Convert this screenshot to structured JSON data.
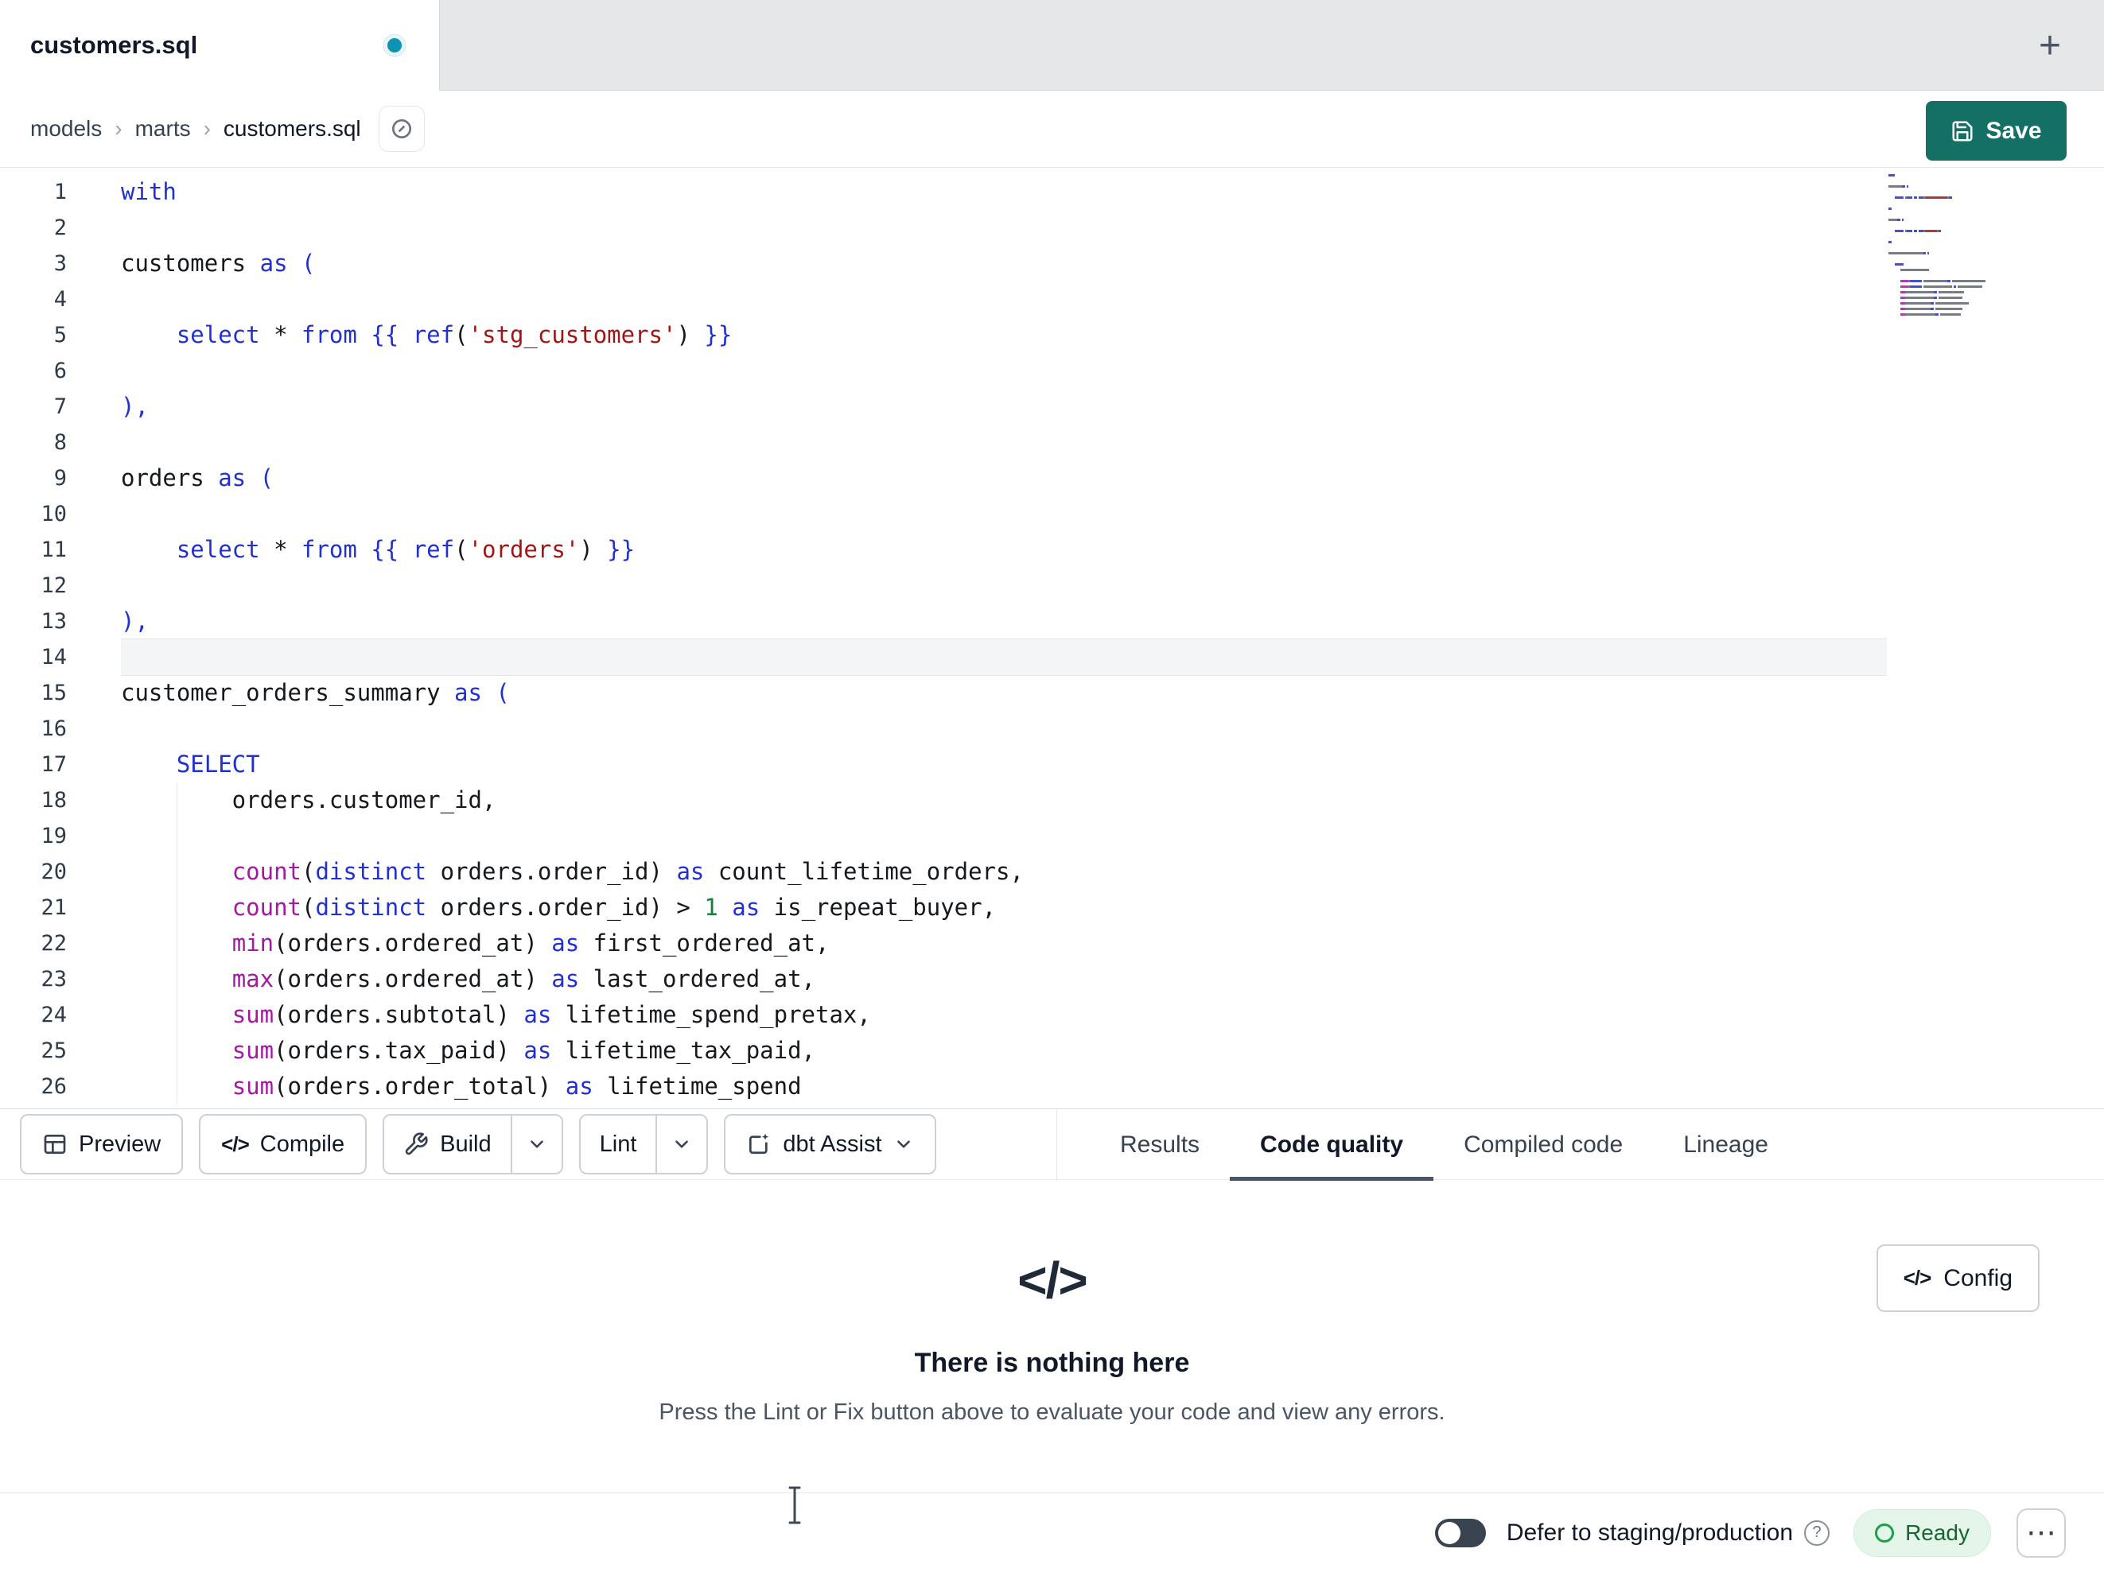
{
  "tab": {
    "title": "customers.sql",
    "new_tab": "+"
  },
  "breadcrumb": {
    "items": [
      "models",
      "marts",
      "customers.sql"
    ]
  },
  "save": {
    "label": "Save"
  },
  "toolbar": {
    "preview": "Preview",
    "compile": "Compile",
    "build": "Build",
    "lint": "Lint",
    "assist": "dbt Assist"
  },
  "panel_tabs": [
    {
      "label": "Results",
      "active": false
    },
    {
      "label": "Code quality",
      "active": true
    },
    {
      "label": "Compiled code",
      "active": false
    },
    {
      "label": "Lineage",
      "active": false
    }
  ],
  "empty_state": {
    "title": "There is nothing here",
    "subtitle": "Press the Lint or Fix button above to evaluate your code and view any errors.",
    "config": "Config"
  },
  "statusbar": {
    "defer_label": "Defer to staging/production",
    "help": "?",
    "ready": "Ready",
    "menu": "⋯"
  },
  "icons": {
    "code_glyph": "</>"
  },
  "colors": {
    "keyword": "#2130d2",
    "function": "#a617a3",
    "string": "#a31515",
    "number": "#15803d",
    "save_button": "#147065",
    "unsaved_dot": "#0f93b4",
    "ready_green": "#19a24a"
  },
  "editor": {
    "active_line": 14,
    "lines": [
      {
        "n": 1,
        "t": [
          [
            "kw",
            "with"
          ]
        ]
      },
      {
        "n": 2,
        "t": []
      },
      {
        "n": 3,
        "t": [
          [
            "tx",
            "customers "
          ],
          [
            "kw",
            "as"
          ],
          [
            "tx",
            " "
          ],
          [
            "kw",
            "("
          ]
        ]
      },
      {
        "n": 4,
        "t": []
      },
      {
        "n": 5,
        "t": [
          [
            "tx",
            "    "
          ],
          [
            "kw",
            "select"
          ],
          [
            "tx",
            " * "
          ],
          [
            "kw",
            "from"
          ],
          [
            "tx",
            " "
          ],
          [
            "kw",
            "{{"
          ],
          [
            "tx",
            " "
          ],
          [
            "kw",
            "ref"
          ],
          [
            "tx",
            "("
          ],
          [
            "st",
            "'stg_customers'"
          ],
          [
            "tx",
            ") "
          ],
          [
            "kw",
            "}}"
          ]
        ]
      },
      {
        "n": 6,
        "t": []
      },
      {
        "n": 7,
        "t": [
          [
            "kw",
            "),"
          ]
        ]
      },
      {
        "n": 8,
        "t": []
      },
      {
        "n": 9,
        "t": [
          [
            "tx",
            "orders "
          ],
          [
            "kw",
            "as"
          ],
          [
            "tx",
            " "
          ],
          [
            "kw",
            "("
          ]
        ]
      },
      {
        "n": 10,
        "t": []
      },
      {
        "n": 11,
        "t": [
          [
            "tx",
            "    "
          ],
          [
            "kw",
            "select"
          ],
          [
            "tx",
            " * "
          ],
          [
            "kw",
            "from"
          ],
          [
            "tx",
            " "
          ],
          [
            "kw",
            "{{"
          ],
          [
            "tx",
            " "
          ],
          [
            "kw",
            "ref"
          ],
          [
            "tx",
            "("
          ],
          [
            "st",
            "'orders'"
          ],
          [
            "tx",
            ") "
          ],
          [
            "kw",
            "}}"
          ]
        ]
      },
      {
        "n": 12,
        "t": []
      },
      {
        "n": 13,
        "t": [
          [
            "kw",
            "),"
          ]
        ]
      },
      {
        "n": 14,
        "t": []
      },
      {
        "n": 15,
        "t": [
          [
            "tx",
            "customer_orders_summary "
          ],
          [
            "kw",
            "as"
          ],
          [
            "tx",
            " "
          ],
          [
            "kw",
            "("
          ]
        ]
      },
      {
        "n": 16,
        "t": []
      },
      {
        "n": 17,
        "t": [
          [
            "tx",
            "    "
          ],
          [
            "kw",
            "SELECT"
          ]
        ]
      },
      {
        "n": 18,
        "t": [
          [
            "tx",
            "        orders.customer_id,"
          ]
        ]
      },
      {
        "n": 19,
        "t": []
      },
      {
        "n": 20,
        "t": [
          [
            "tx",
            "        "
          ],
          [
            "fn",
            "count"
          ],
          [
            "tx",
            "("
          ],
          [
            "kw",
            "distinct"
          ],
          [
            "tx",
            " orders.order_id) "
          ],
          [
            "kw",
            "as"
          ],
          [
            "tx",
            " count_lifetime_orders,"
          ]
        ]
      },
      {
        "n": 21,
        "t": [
          [
            "tx",
            "        "
          ],
          [
            "fn",
            "count"
          ],
          [
            "tx",
            "("
          ],
          [
            "kw",
            "distinct"
          ],
          [
            "tx",
            " orders.order_id) > "
          ],
          [
            "nu",
            "1"
          ],
          [
            "tx",
            " "
          ],
          [
            "kw",
            "as"
          ],
          [
            "tx",
            " is_repeat_buyer,"
          ]
        ]
      },
      {
        "n": 22,
        "t": [
          [
            "tx",
            "        "
          ],
          [
            "fn",
            "min"
          ],
          [
            "tx",
            "(orders.ordered_at) "
          ],
          [
            "kw",
            "as"
          ],
          [
            "tx",
            " first_ordered_at,"
          ]
        ]
      },
      {
        "n": 23,
        "t": [
          [
            "tx",
            "        "
          ],
          [
            "fn",
            "max"
          ],
          [
            "tx",
            "(orders.ordered_at) "
          ],
          [
            "kw",
            "as"
          ],
          [
            "tx",
            " last_ordered_at,"
          ]
        ]
      },
      {
        "n": 24,
        "t": [
          [
            "tx",
            "        "
          ],
          [
            "fn",
            "sum"
          ],
          [
            "tx",
            "(orders.subtotal) "
          ],
          [
            "kw",
            "as"
          ],
          [
            "tx",
            " lifetime_spend_pretax,"
          ]
        ]
      },
      {
        "n": 25,
        "t": [
          [
            "tx",
            "        "
          ],
          [
            "fn",
            "sum"
          ],
          [
            "tx",
            "(orders.tax_paid) "
          ],
          [
            "kw",
            "as"
          ],
          [
            "tx",
            " lifetime_tax_paid,"
          ]
        ]
      },
      {
        "n": 26,
        "t": [
          [
            "tx",
            "        "
          ],
          [
            "fn",
            "sum"
          ],
          [
            "tx",
            "(orders.order_total) "
          ],
          [
            "kw",
            "as"
          ],
          [
            "tx",
            " lifetime_spend"
          ]
        ]
      }
    ]
  }
}
